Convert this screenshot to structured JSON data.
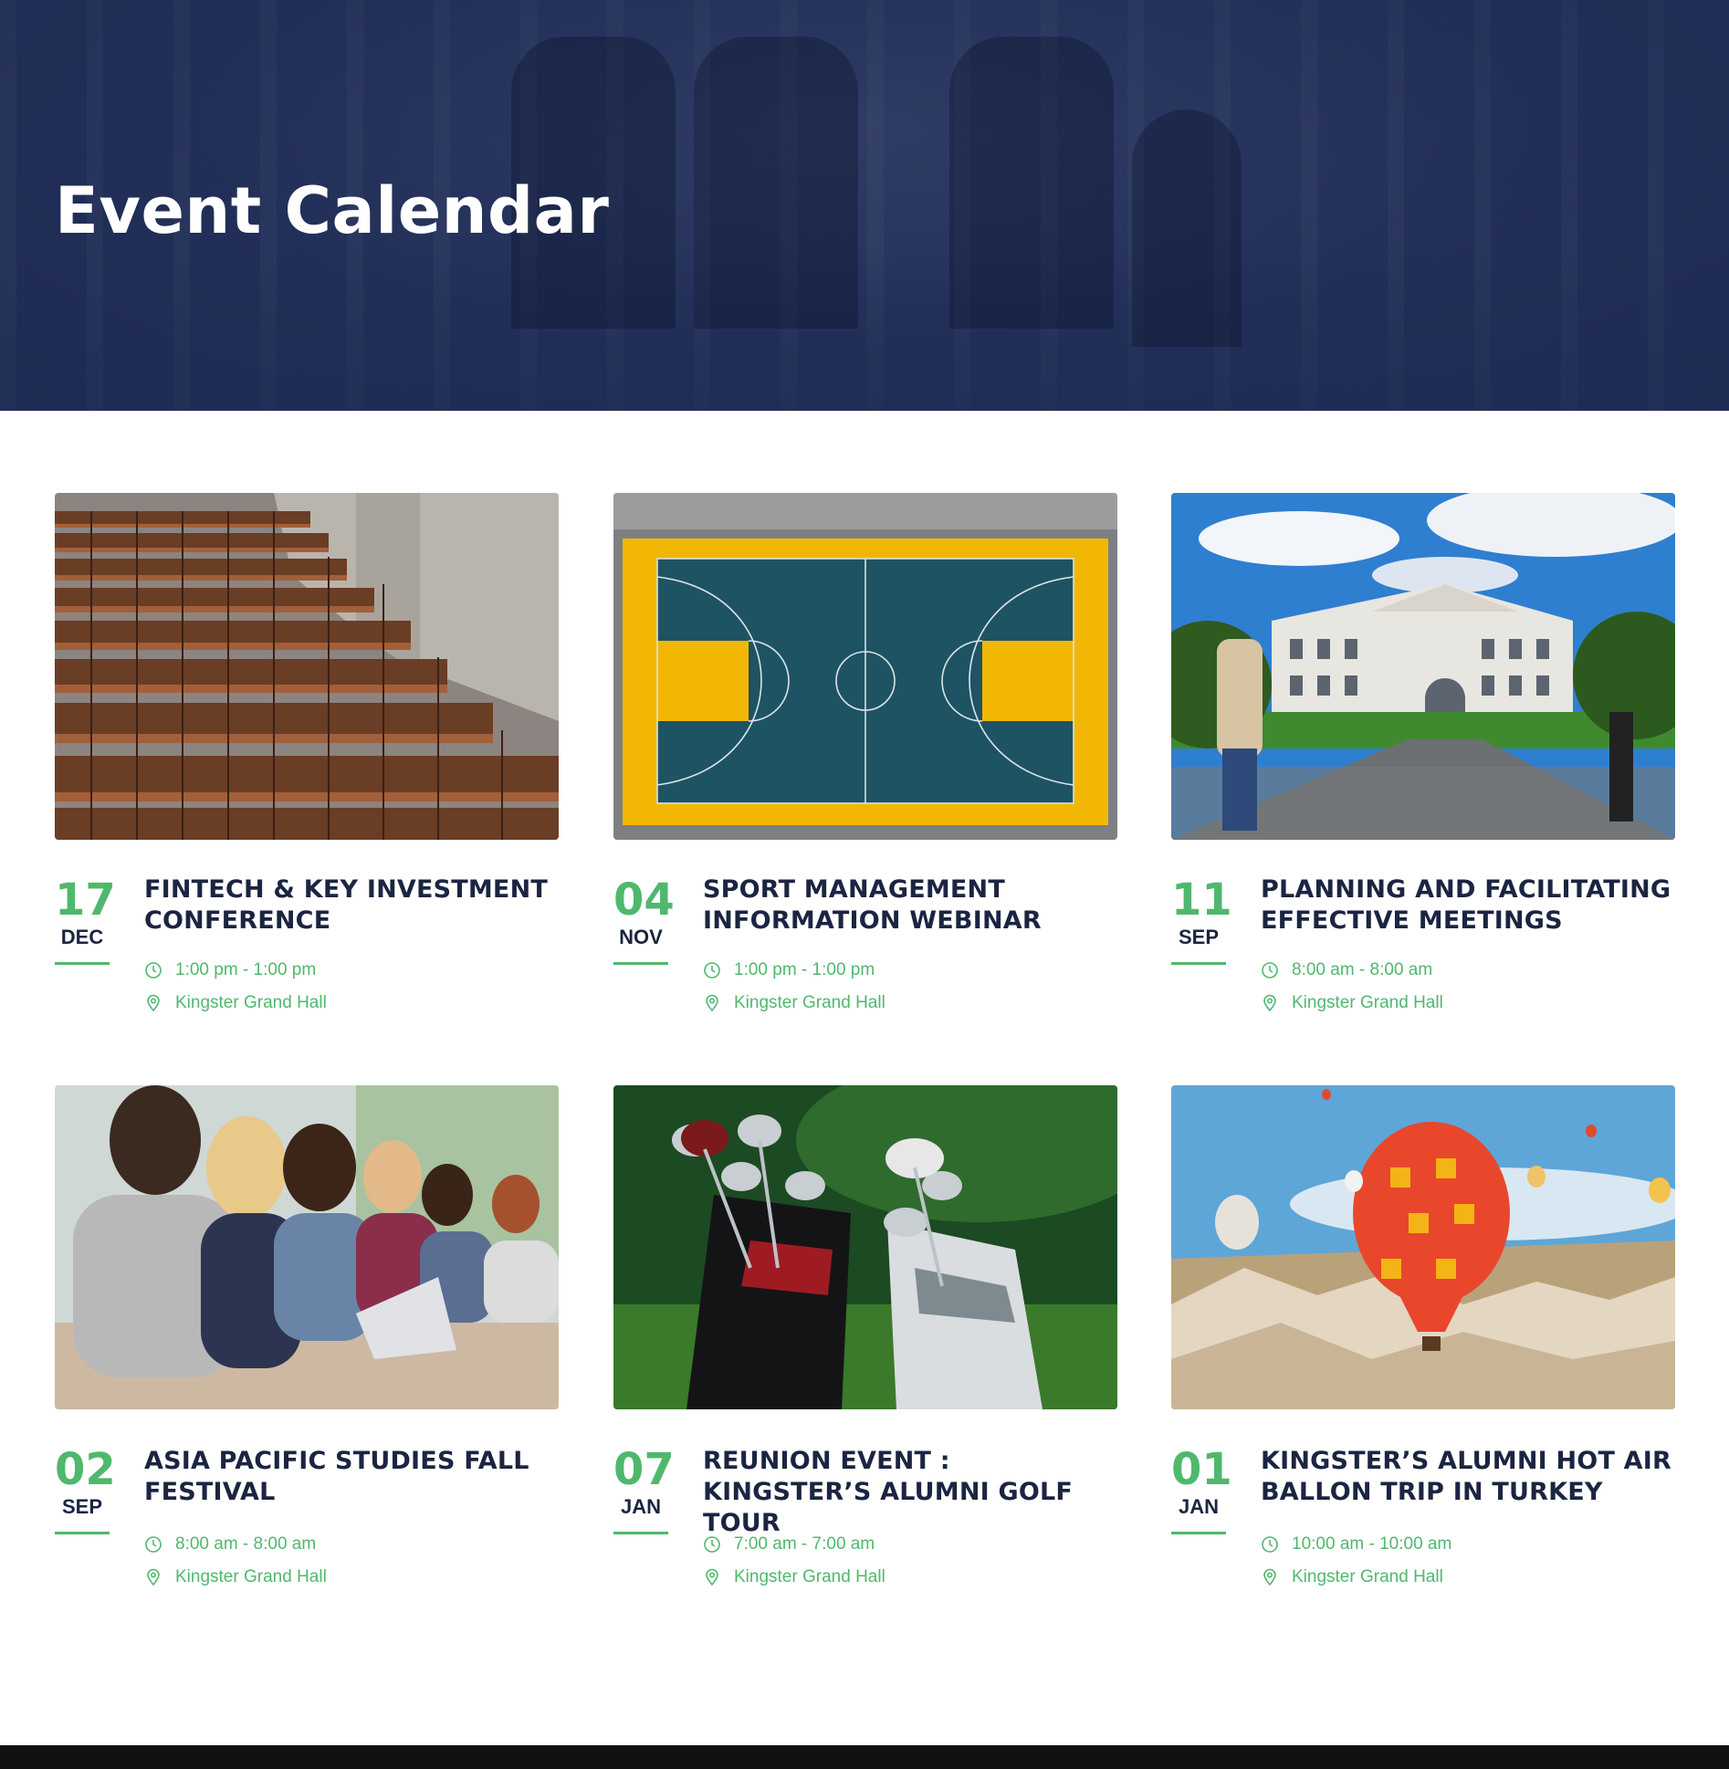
{
  "hero": {
    "title": "Event Calendar"
  },
  "theme": {
    "accent": "#4fb86d",
    "navy": "#1b2542",
    "hero_bg": "#1f2d56"
  },
  "events": [
    {
      "day": "17",
      "month": "DEC",
      "title": "FINTECH & KEY INVESTMENT CONFERENCE",
      "time": "1:00 pm - 1:00 pm",
      "location": "Kingster Grand Hall",
      "image": "auditorium-seats"
    },
    {
      "day": "04",
      "month": "NOV",
      "title": "SPORT MANAGEMENT INFORMATION WEBINAR",
      "time": "1:00 pm - 1:00 pm",
      "location": "Kingster Grand Hall",
      "image": "basketball-court"
    },
    {
      "day": "11",
      "month": "SEP",
      "title": "PLANNING AND FACILITATING EFFECTIVE MEETINGS",
      "time": "8:00 am - 8:00 am",
      "location": "Kingster Grand Hall",
      "image": "campus-building"
    },
    {
      "day": "02",
      "month": "SEP",
      "title": "ASIA PACIFIC STUDIES FALL FESTIVAL",
      "time": "8:00 am - 8:00 am",
      "location": "Kingster Grand Hall",
      "image": "students-laptops"
    },
    {
      "day": "07",
      "month": "JAN",
      "title": "REUNION EVENT : KINGSTER’S ALUMNI GOLF TOUR",
      "time": "7:00 am - 7:00 am",
      "location": "Kingster Grand Hall",
      "image": "golf-bags"
    },
    {
      "day": "01",
      "month": "JAN",
      "title": "KINGSTER’S ALUMNI HOT AIR BALLON TRIP IN TURKEY",
      "time": "10:00 am - 10:00 am",
      "location": "Kingster Grand Hall",
      "image": "hot-air-balloons"
    }
  ]
}
